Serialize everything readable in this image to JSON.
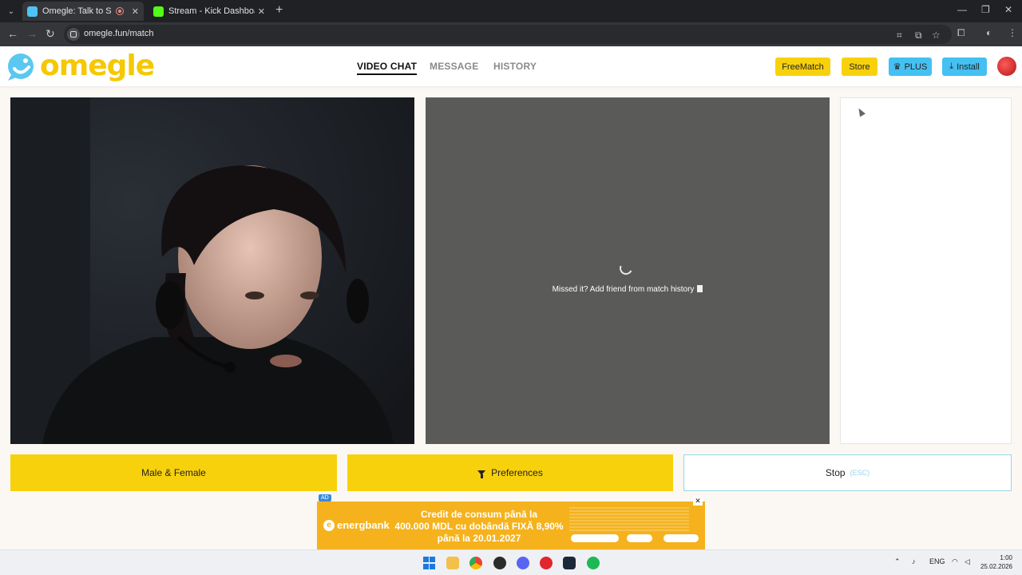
{
  "browser": {
    "tabs": [
      {
        "title": "Omegle: Talk to Strangers via",
        "active": true
      },
      {
        "title": "Stream - Kick Dashboard",
        "active": false
      }
    ],
    "url": "omegle.fun/match"
  },
  "header": {
    "logo_text": "omegle",
    "nav": [
      "VIDEO CHAT",
      "MESSAGE",
      "HISTORY"
    ],
    "active_nav": "VIDEO CHAT",
    "buttons": {
      "freematch": "FreeMatch",
      "store": "Store",
      "plus": "PLUS",
      "install": "Install"
    }
  },
  "peer": {
    "missed_text": "Missed it? Add friend from match history"
  },
  "controls": {
    "gender": "Male & Female",
    "preferences": "Preferences",
    "stop": "Stop",
    "stop_hint": "(ESC)"
  },
  "ad": {
    "badge": "AD",
    "brand": "energbank",
    "headline": [
      "Credit de consum până la",
      "400.000 MDL cu dobândă FIXĂ 8,90%",
      "până la 20.01.2027"
    ]
  },
  "taskbar": {
    "lang": "ENG",
    "time": "1:00",
    "date": "25.02.2026"
  },
  "colors": {
    "brand_yellow": "#f8d10d",
    "plus_blue": "#45c0f2",
    "peer_bg": "#5a5b58"
  },
  "icons": [
    "menu-icon",
    "omegle-favicon",
    "record-icon",
    "kick-favicon",
    "back-icon",
    "forward-icon",
    "reload-icon",
    "translate-icon",
    "install-icon",
    "star-icon",
    "extensions-icon",
    "profile-icon",
    "more-icon",
    "crown-icon",
    "download-icon",
    "funnel-icon",
    "document-icon",
    "spinner-icon"
  ]
}
